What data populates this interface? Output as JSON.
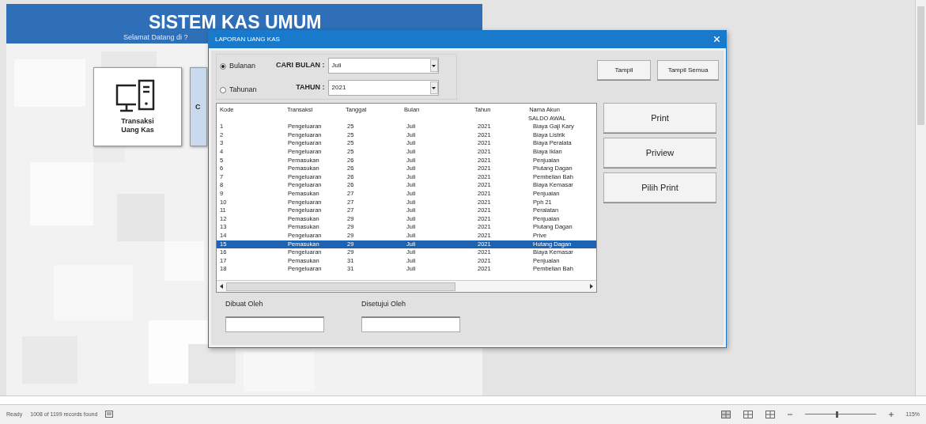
{
  "banner": {
    "title": "SISTEM KAS UMUM",
    "subtitle": "Selamat Datang di ?"
  },
  "cards": [
    {
      "label": "Transaksi Uang Kas"
    },
    {
      "label": "C"
    }
  ],
  "dialog": {
    "title": "LAPORAN UANG KAS",
    "radios": [
      {
        "label": "Bulanan",
        "selected": true
      },
      {
        "label": "Tahunan",
        "selected": false
      }
    ],
    "filters": [
      {
        "label": "CARI BULAN :",
        "value": "Juli"
      },
      {
        "label": "TAHUN :",
        "value": "2021"
      }
    ],
    "top_buttons": [
      "Tampil",
      "Tampil Semua"
    ],
    "side_buttons": [
      "Print",
      "Priview",
      "Pilih Print"
    ],
    "table": {
      "columns": [
        "Kode",
        "Transaksi",
        "Tanggal",
        "Bulan",
        "Tahun",
        "Nama Akun"
      ],
      "rows": [
        {
          "cells": [
            "",
            "",
            "",
            "",
            "",
            "SALDO AWAL"
          ],
          "selected": false
        },
        {
          "cells": [
            "1",
            "Pengeluaran",
            "25",
            "Juli",
            "2021",
            "Biaya Gaji Kary"
          ],
          "selected": false
        },
        {
          "cells": [
            "2",
            "Pengeluaran",
            "25",
            "Juli",
            "2021",
            "Biaya Listrik"
          ],
          "selected": false
        },
        {
          "cells": [
            "3",
            "Pengeluaran",
            "25",
            "Juli",
            "2021",
            "Biaya Peralata"
          ],
          "selected": false
        },
        {
          "cells": [
            "4",
            "Pengeluaran",
            "25",
            "Juli",
            "2021",
            "Biaya Iklan"
          ],
          "selected": false
        },
        {
          "cells": [
            "5",
            "Pemasukan",
            "26",
            "Juli",
            "2021",
            "Penjualan"
          ],
          "selected": false
        },
        {
          "cells": [
            "6",
            "Pemasukan",
            "26",
            "Juli",
            "2021",
            "Piutang Dagan"
          ],
          "selected": false
        },
        {
          "cells": [
            "7",
            "Pengeluaran",
            "26",
            "Juli",
            "2021",
            "Pembelian Bah"
          ],
          "selected": false
        },
        {
          "cells": [
            "8",
            "Pengeluaran",
            "26",
            "Juli",
            "2021",
            "Biaya Kemasar"
          ],
          "selected": false
        },
        {
          "cells": [
            "9",
            "Pemasukan",
            "27",
            "Juli",
            "2021",
            "Penjualan"
          ],
          "selected": false
        },
        {
          "cells": [
            "10",
            "Pengeluaran",
            "27",
            "Juli",
            "2021",
            "Pph 21"
          ],
          "selected": false
        },
        {
          "cells": [
            "11",
            "Pengeluaran",
            "27",
            "Juli",
            "2021",
            "Peralatan"
          ],
          "selected": false
        },
        {
          "cells": [
            "12",
            "Pemasukan",
            "29",
            "Juli",
            "2021",
            "Penjualan"
          ],
          "selected": false
        },
        {
          "cells": [
            "13",
            "Pemasukan",
            "29",
            "Juli",
            "2021",
            "Piutang Dagan"
          ],
          "selected": false
        },
        {
          "cells": [
            "14",
            "Pengeluaran",
            "29",
            "Juli",
            "2021",
            "Prive"
          ],
          "selected": false
        },
        {
          "cells": [
            "15",
            "Pemasukan",
            "29",
            "Juli",
            "2021",
            "Hutang Dagan"
          ],
          "selected": true
        },
        {
          "cells": [
            "16",
            "Pengeluaran",
            "29",
            "Juli",
            "2021",
            "Biaya Kemasar"
          ],
          "selected": false
        },
        {
          "cells": [
            "17",
            "Pemasukan",
            "31",
            "Juli",
            "2021",
            "Penjualan"
          ],
          "selected": false
        },
        {
          "cells": [
            "18",
            "Pengeluaran",
            "31",
            "Juli",
            "2021",
            "Pembelian Bah"
          ],
          "selected": false
        }
      ]
    },
    "signers": [
      {
        "label": "Dibuat Oleh"
      },
      {
        "label": "Disetujui Oleh"
      }
    ]
  },
  "status_bar": {
    "status": "Ready",
    "records": "1008 of 1199 records found",
    "zoom": {
      "level": 0.45,
      "reading": "115%"
    }
  }
}
